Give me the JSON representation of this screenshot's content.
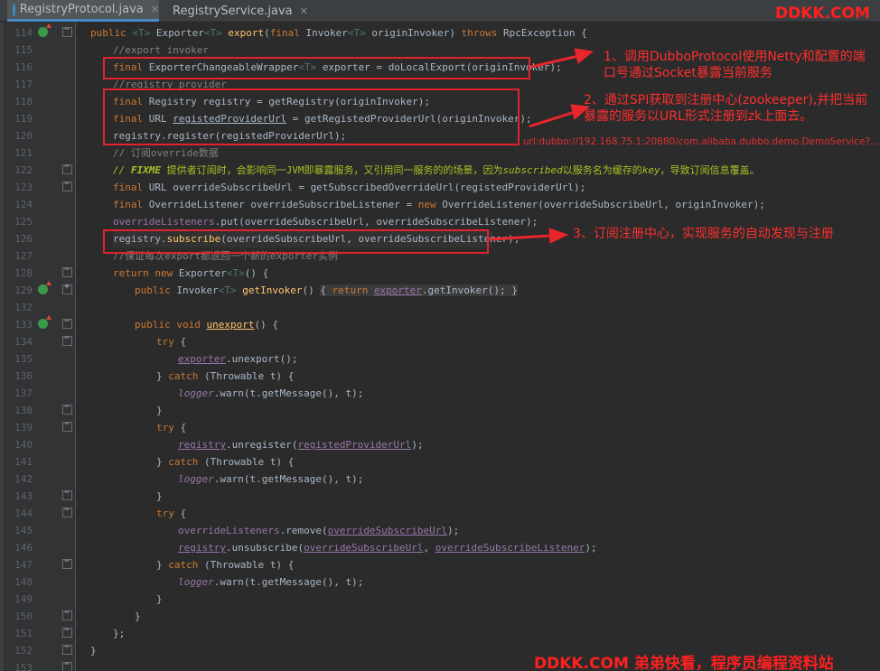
{
  "tabs": [
    {
      "label": "RegistryProtocol.java",
      "active": true,
      "icon": "class-icon"
    },
    {
      "label": "RegistryService.java",
      "active": false,
      "icon": "interface-icon"
    }
  ],
  "line_numbers": [
    "114",
    "115",
    "116",
    "117",
    "118",
    "119",
    "120",
    "121",
    "122",
    "123",
    "124",
    "125",
    "126",
    "127",
    "128",
    "129",
    "132",
    "133",
    "134",
    "135",
    "136",
    "137",
    "138",
    "139",
    "140",
    "141",
    "142",
    "143",
    "144",
    "145",
    "146",
    "147",
    "148",
    "149",
    "150",
    "151",
    "152",
    "153"
  ],
  "annotations": {
    "note1": "1、调用DubboProtocol使用Netty和配置的端口号通过Socket暴露当前服务",
    "note2": "2、通过SPI获取到注册中心(zookeeper),并把当前暴露的服务以URL形式注册到zk上面去。",
    "note3": "3、订阅注册中心，实现服务的自动发现与注册",
    "url": "url:dubbo://192.168.75.1:20880/com.alibaba.dubbo.demo.DemoService?....."
  },
  "watermark": {
    "top": "DDKK.COM",
    "bottom": "DDKK.COM 弟弟快看，程序员编程资料站"
  },
  "code": {
    "l114": [
      "public ",
      "<T> ",
      "Exporter",
      "<T> ",
      "export",
      "(",
      "final ",
      "Invoker",
      "<T> ",
      "originInvoker) ",
      "throws ",
      "RpcException {"
    ],
    "l115": "//export invoker",
    "l116": [
      "final ",
      "ExporterChangeableWrapper",
      "<T> ",
      "exporter = ",
      "doLocalExport",
      "(originInvoker);"
    ],
    "l117": "//registry provider",
    "l118": [
      "final ",
      "Registry registry = ",
      "getRegistry",
      "(originInvoker);"
    ],
    "l119": [
      "final ",
      "URL ",
      "registedProviderUrl",
      " = ",
      "getRegistedProviderUrl",
      "(originInvoker);"
    ],
    "l120": [
      "registry.register(registedProviderUrl);"
    ],
    "l121": "// 订阅override数据",
    "l122": [
      "// ",
      "FIXME",
      " 提供者订阅时，会影响同一JVM即暴露服务，又引用同一服务的的场景，因为",
      "subscribed",
      "以服务名为缓存的",
      "key",
      "，导致订阅信息覆盖。"
    ],
    "l123": [
      "final ",
      "URL overrideSubscribeUrl = ",
      "getSubscribedOverrideUrl",
      "(registedProviderUrl);"
    ],
    "l124": [
      "final ",
      "OverrideListener overrideSubscribeListener = ",
      "new ",
      "OverrideListener(overrideSubscribeUrl, originInvoker);"
    ],
    "l125": [
      "overrideListeners",
      ".put(overrideSubscribeUrl, overrideSubscribeListener);"
    ],
    "l126": [
      "registry.",
      "subscribe",
      "(overrideSubscribeUrl, overrideSubscribeListener);"
    ],
    "l127": "//保证每次export都返回一个新的exporter实例",
    "l128": [
      "return new ",
      "Exporter",
      "<T>",
      "() {"
    ],
    "l129": [
      "public ",
      "Invoker",
      "<T> ",
      "getInvoker",
      "() ",
      "{ ",
      "return ",
      "exporter",
      ".getInvoker(); }"
    ],
    "l133": [
      "public void ",
      "unexport",
      "() {"
    ],
    "l134": [
      "try ",
      "{"
    ],
    "l135": [
      "exporter",
      ".unexport();"
    ],
    "l136": [
      "} ",
      "catch ",
      "(Throwable t) {"
    ],
    "l137": [
      "logger",
      ".warn(t.getMessage(), t);"
    ],
    "l138": "}",
    "l139": [
      "try ",
      "{"
    ],
    "l140": [
      "registry",
      ".unregister(",
      "registedProviderUrl",
      ");"
    ],
    "l141": [
      "} ",
      "catch ",
      "(Throwable t) {"
    ],
    "l142": [
      "logger",
      ".warn(t.getMessage(), t);"
    ],
    "l143": "}",
    "l144": [
      "try ",
      "{"
    ],
    "l145": [
      "overrideListeners",
      ".remove(",
      "overrideSubscribeUrl",
      ");"
    ],
    "l146": [
      "registry",
      ".unsubscribe(",
      "overrideSubscribeUrl",
      ", ",
      "overrideSubscribeListener",
      ");"
    ],
    "l147": [
      "} ",
      "catch ",
      "(Throwable t) {"
    ],
    "l148": [
      "logger",
      ".warn(t.getMessage(), t);"
    ],
    "l149": "}",
    "l150": "}",
    "l151": "};",
    "l152": "}"
  }
}
